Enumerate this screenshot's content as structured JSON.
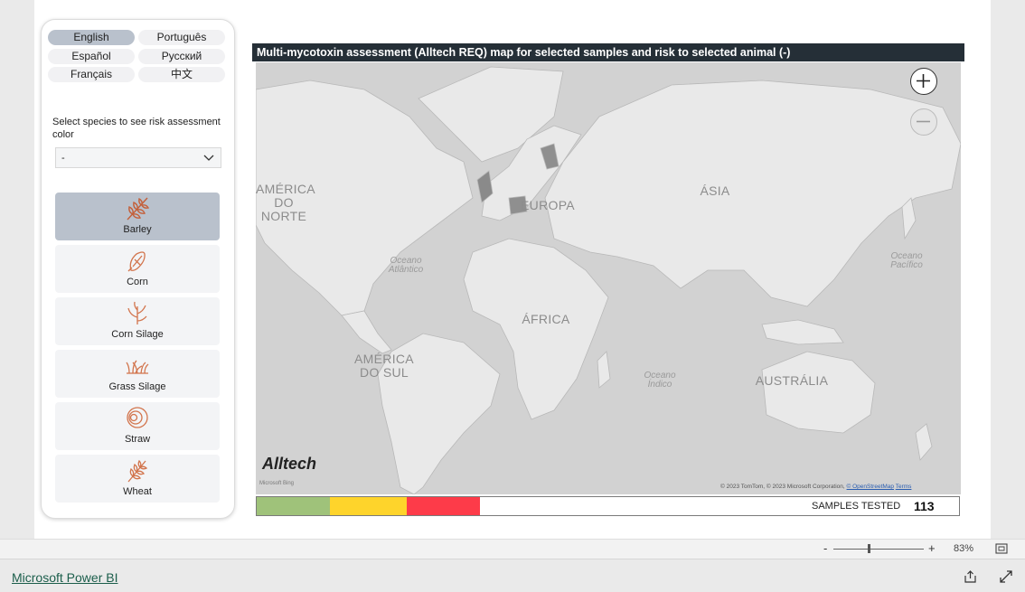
{
  "languages": [
    "English",
    "Português",
    "Español",
    "Русский",
    "Français",
    "中文"
  ],
  "active_language": "English",
  "species_select": {
    "label": "Select species to see risk assessment color",
    "value": "-"
  },
  "crops": [
    {
      "label": "Barley",
      "icon": "barley-icon",
      "active": true
    },
    {
      "label": "Corn",
      "icon": "corn-icon",
      "active": false
    },
    {
      "label": "Corn Silage",
      "icon": "corn-silage-icon",
      "active": false
    },
    {
      "label": "Grass Silage",
      "icon": "grass-silage-icon",
      "active": false
    },
    {
      "label": "Straw",
      "icon": "straw-icon",
      "active": false
    },
    {
      "label": "Wheat",
      "icon": "wheat-icon",
      "active": false
    }
  ],
  "map": {
    "title": "Multi-mycotoxin assessment (Alltech REQ) map for selected samples and risk to selected animal (-)",
    "labels": {
      "north_america": "AMÉRICA DO NORTE",
      "europe": "EUROPA",
      "asia": "ÁSIA",
      "africa": "ÁFRICA",
      "south_america": "AMÉRICA DO SUL",
      "australia": "AUSTRÁLIA",
      "atlantic": "Oceano Atlântico",
      "pacific": "Oceano Pacífico",
      "indian": "Oceano Índico"
    },
    "logo": "Alltech",
    "bing": "Microsoft Bing",
    "copyright_prefix": "© 2023 TomTom, © 2023 Microsoft Corporation,",
    "osm_link": "© OpenStreetMap",
    "terms_link": "Terms",
    "zoom_in": "+",
    "zoom_out": "−"
  },
  "legend": {
    "colors": [
      "#9fc27a",
      "#fed42b",
      "#fd3b49"
    ],
    "samples_label": "SAMPLES TESTED",
    "samples_value": "113"
  },
  "zoom": {
    "minus": "-",
    "plus": "+",
    "level": "83%"
  },
  "footer": {
    "link": "Microsoft Power BI"
  }
}
